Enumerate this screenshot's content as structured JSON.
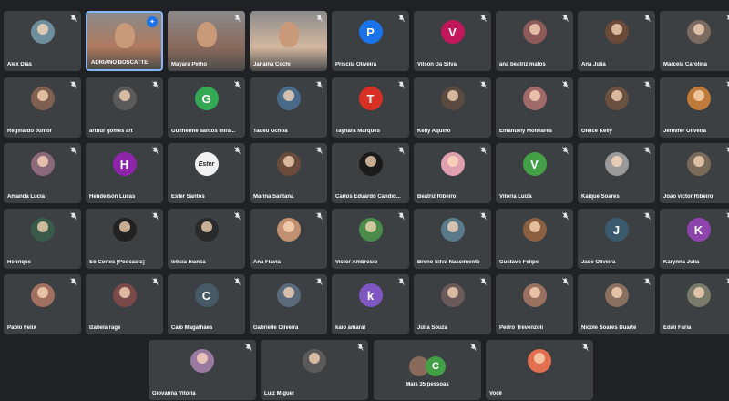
{
  "participants": [
    {
      "name": "Alex Dias",
      "avatar": {
        "type": "photo",
        "color": "#6f8f9c"
      }
    },
    {
      "name": "ADRIANO BOSCATTE",
      "avatar": {
        "type": "video",
        "color": "#b07a5e"
      },
      "active": true,
      "pinned": true
    },
    {
      "name": "Mayara Pinho",
      "avatar": {
        "type": "video",
        "color": "#8a6a5c"
      }
    },
    {
      "name": "Janaina Cochi",
      "avatar": {
        "type": "video",
        "color": "#d4b8a0"
      }
    },
    {
      "name": "Priscila Oliveira",
      "avatar": {
        "type": "letter",
        "letter": "P",
        "color": "#1a73e8"
      }
    },
    {
      "name": "Vilson Da Silva",
      "avatar": {
        "type": "letter",
        "letter": "V",
        "color": "#c2185b"
      }
    },
    {
      "name": "ana beatriz matos",
      "avatar": {
        "type": "photo",
        "color": "#8d5a5a"
      }
    },
    {
      "name": "Ana Júlia",
      "avatar": {
        "type": "photo",
        "color": "#6b4a3a"
      }
    },
    {
      "name": "Marcela Carolina",
      "avatar": {
        "type": "photo",
        "color": "#7a6a60"
      }
    },
    {
      "name": "Reginaldo Júnior",
      "avatar": {
        "type": "photo",
        "color": "#7f5f4f"
      }
    },
    {
      "name": "arthur gomes art",
      "avatar": {
        "type": "photo",
        "color": "#5a5a5a"
      }
    },
    {
      "name": "Guilherme santos mira...",
      "avatar": {
        "type": "letter",
        "letter": "G",
        "color": "#34a853"
      }
    },
    {
      "name": "Tadeu Ochoa",
      "avatar": {
        "type": "photo",
        "color": "#4a6a8a"
      }
    },
    {
      "name": "Taynara Marques",
      "avatar": {
        "type": "letter",
        "letter": "T",
        "color": "#d93025"
      }
    },
    {
      "name": "Kelly Aquino",
      "avatar": {
        "type": "photo",
        "color": "#5a4a40"
      }
    },
    {
      "name": "Emanuely Molinares",
      "avatar": {
        "type": "photo",
        "color": "#a06a6a"
      }
    },
    {
      "name": "Gleice Kelly",
      "avatar": {
        "type": "photo",
        "color": "#6a5040"
      }
    },
    {
      "name": "Jennifer Oliveira",
      "avatar": {
        "type": "photo",
        "color": "#c07a3a"
      }
    },
    {
      "name": "Amanda Lucia",
      "avatar": {
        "type": "photo",
        "color": "#8a6a7a"
      }
    },
    {
      "name": "Henderson Lucas",
      "avatar": {
        "type": "letter",
        "letter": "H",
        "color": "#8e24aa"
      }
    },
    {
      "name": "Ester Santos",
      "avatar": {
        "type": "text",
        "letter": "Ester",
        "color": "#f1f1f1"
      }
    },
    {
      "name": "Marina Santana",
      "avatar": {
        "type": "photo",
        "color": "#6a4a3a"
      }
    },
    {
      "name": "Carlos Eduardo Candid...",
      "avatar": {
        "type": "photo",
        "color": "#1a1a1a"
      }
    },
    {
      "name": "Beatriz Ribeiro",
      "avatar": {
        "type": "photo",
        "color": "#e0a0b0"
      }
    },
    {
      "name": "Vitoria Luiza",
      "avatar": {
        "type": "letter",
        "letter": "V",
        "color": "#43a047"
      }
    },
    {
      "name": "Kaique Soares",
      "avatar": {
        "type": "photo",
        "color": "#9a9a9a"
      }
    },
    {
      "name": "Joao victor Ribeiro",
      "avatar": {
        "type": "photo",
        "color": "#7a6a5a"
      }
    },
    {
      "name": "Henrique",
      "avatar": {
        "type": "photo",
        "color": "#3a5a4a"
      }
    },
    {
      "name": "Só Cortes [Podcasts]",
      "avatar": {
        "type": "photo",
        "color": "#222222"
      }
    },
    {
      "name": "leticia bianca",
      "avatar": {
        "type": "photo",
        "color": "#2a2a2a"
      }
    },
    {
      "name": "Ana Flávia",
      "avatar": {
        "type": "photo",
        "color": "#c09070"
      }
    },
    {
      "name": "Victor Ambrosio",
      "avatar": {
        "type": "photo",
        "color": "#4a8a4a"
      }
    },
    {
      "name": "Breno Silva Nascimento",
      "avatar": {
        "type": "photo",
        "color": "#5a7a8a"
      }
    },
    {
      "name": "Gustavo Felipe",
      "avatar": {
        "type": "photo",
        "color": "#8a6040"
      }
    },
    {
      "name": "Jade Oliveira",
      "avatar": {
        "type": "letter",
        "letter": "J",
        "color": "#3c5a6e"
      }
    },
    {
      "name": "Karynna Julia",
      "avatar": {
        "type": "letter",
        "letter": "K",
        "color": "#8e44ad"
      }
    },
    {
      "name": "Pablo Felix",
      "avatar": {
        "type": "photo",
        "color": "#a07060"
      }
    },
    {
      "name": "Izabela rage",
      "avatar": {
        "type": "photo",
        "color": "#7a4a4a"
      }
    },
    {
      "name": "Caio Magalhães",
      "avatar": {
        "type": "letter",
        "letter": "C",
        "color": "#455a64"
      }
    },
    {
      "name": "Gabrielle Oliveira",
      "avatar": {
        "type": "photo",
        "color": "#5a6a7a"
      }
    },
    {
      "name": "kaio amaral",
      "avatar": {
        "type": "letter",
        "letter": "k",
        "color": "#7e57c2"
      }
    },
    {
      "name": "Júlia Souza",
      "avatar": {
        "type": "photo",
        "color": "#6a5a5a"
      }
    },
    {
      "name": "Pedro Trevenzoli",
      "avatar": {
        "type": "photo",
        "color": "#9a7060"
      }
    },
    {
      "name": "Nicole Soares Duarte",
      "avatar": {
        "type": "photo",
        "color": "#8a7060"
      }
    },
    {
      "name": "Ëdali Faria",
      "avatar": {
        "type": "photo",
        "color": "#7a7a6a"
      }
    }
  ],
  "bottom_tiles": [
    {
      "name": "Giovanna Vitoria",
      "avatar": {
        "type": "photo",
        "color": "#9a7aa0"
      }
    },
    {
      "name": "Luiz Miguel",
      "avatar": {
        "type": "photo",
        "color": "#5a5a5a"
      }
    },
    {
      "name": "Mais 35 pessoas",
      "avatar": {
        "type": "more",
        "letter": "C",
        "color": "#43a047",
        "photo_color": "#8a6a5a"
      }
    },
    {
      "name": "Você",
      "avatar": {
        "type": "photo",
        "color": "#e07050"
      }
    }
  ],
  "icons": {
    "mic_off": "mic-off-icon",
    "pin": "pin-icon"
  }
}
